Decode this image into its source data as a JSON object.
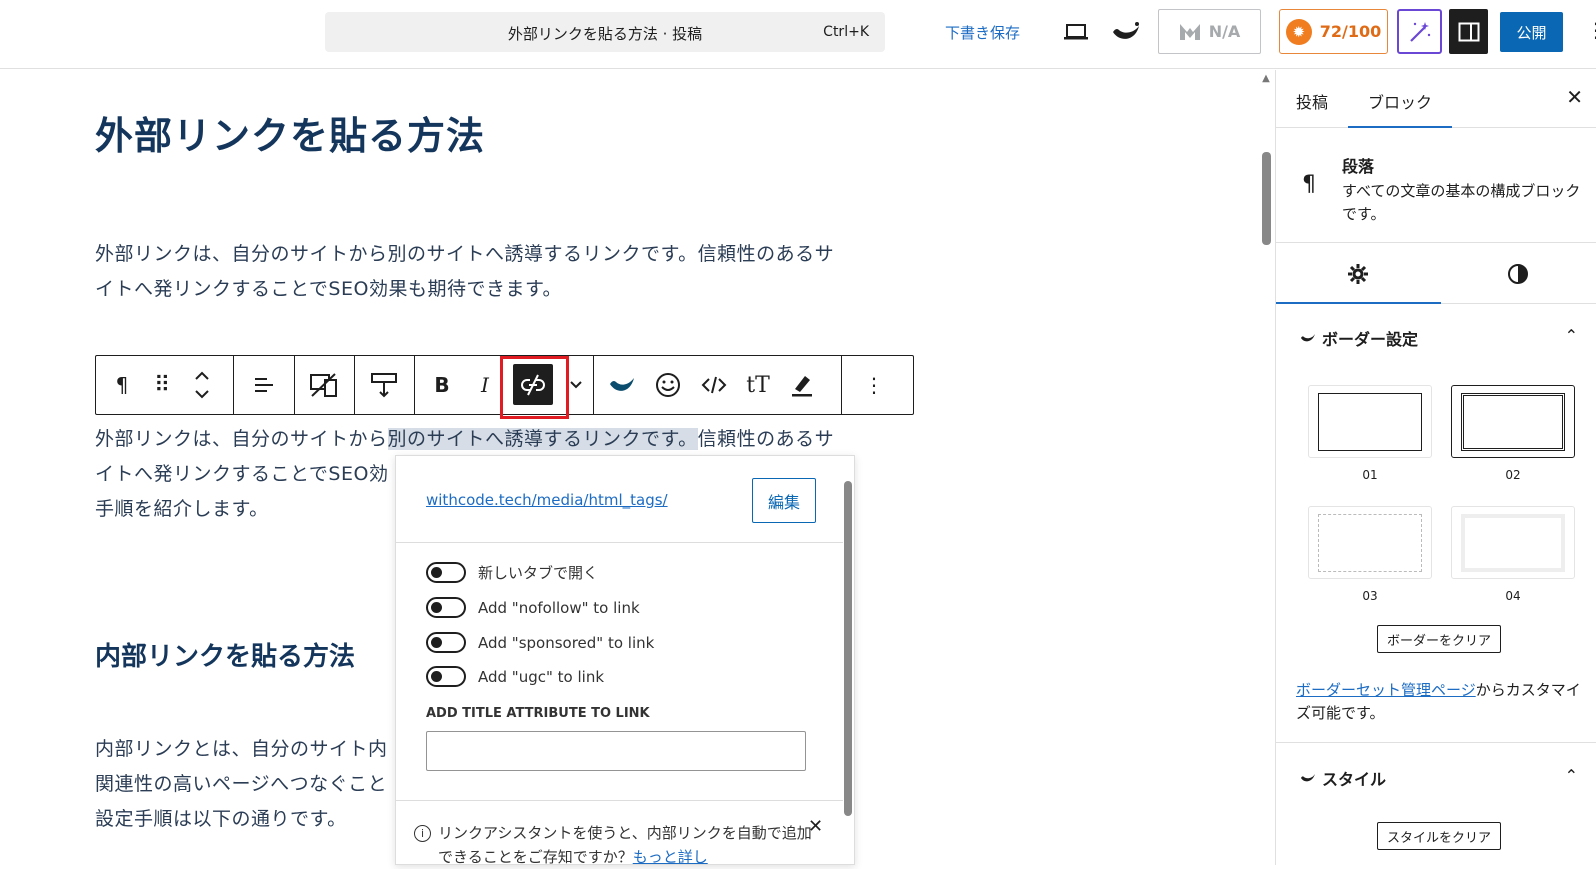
{
  "header": {
    "command_title": "外部リンクを貼る方法 · 投稿",
    "shortcut": "Ctrl+K",
    "save_draft": "下書き保存",
    "na_label": "N/A",
    "score": "72/100",
    "publish": "公開"
  },
  "editor": {
    "title": "外部リンクを貼る方法",
    "para1": "外部リンクは、自分のサイトから別のサイトへ誘導するリンクです。信頼性のあるサイトへ発リンクすることでSEO効果も期待できます。",
    "para1_line1": "外部リンクは、自分のサイトから別のサイトへ誘導するリンクです。信頼性のあるサ",
    "para1_line2": "イトへ発リンクすることでSEO効果も期待できます。",
    "para2_pre": "外部リンクは、自分のサイトから",
    "para2_link": "別のサイトへ誘導するリンクです。",
    "para2_post": "信頼性のあるサ",
    "para2_line2": "イトへ発リンクすることでSEO効",
    "para2_line3": "手順を紹介します。",
    "h2": "内部リンクを貼る方法",
    "para3_line1": "内部リンクとは、自分のサイト内",
    "para3_line2": "関連性の高いページへつなぐこと",
    "para3_line3": "設定手順は以下の通りです。"
  },
  "toolbar": {
    "bold": "B",
    "italic": "I"
  },
  "link_popover": {
    "url": "withcode.tech/media/html_tags/",
    "edit": "編集",
    "toggles": [
      {
        "label": "新しいタブで開く",
        "on": false
      },
      {
        "label": "Add \"nofollow\" to link",
        "on": false
      },
      {
        "label": "Add \"sponsored\" to link",
        "on": false
      },
      {
        "label": "Add \"ugc\" to link",
        "on": false
      }
    ],
    "title_attr_label": "ADD TITLE ATTRIBUTE TO LINK",
    "title_attr_value": "",
    "notice_text": "リンクアシスタントを使うと、内部リンクを自動で追加できることをご存知ですか？",
    "notice_link": "もっと詳し"
  },
  "panel": {
    "tab_post": "投稿",
    "tab_block": "ブロック",
    "block_name": "段落",
    "block_desc": "すべての文章の基本の構成ブロックです。",
    "border_section": "ボーダー設定",
    "border_options": [
      {
        "label": "01",
        "style": "solid"
      },
      {
        "label": "02",
        "style": "double"
      },
      {
        "label": "03",
        "style": "dashed"
      },
      {
        "label": "04",
        "style": "light"
      }
    ],
    "clear_border": "ボーダーをクリア",
    "border_link": "ボーダーセット管理ページ",
    "border_link_suffix": "からカスタマイズ可能です。",
    "style_section": "スタイル",
    "clear_style": "スタイルをクリア"
  },
  "colors": {
    "accent": "#1d6cc4",
    "publish": "#0a67b3",
    "heading": "#14365c",
    "score": "#e06b17",
    "highlight_box": "#e01b22"
  }
}
